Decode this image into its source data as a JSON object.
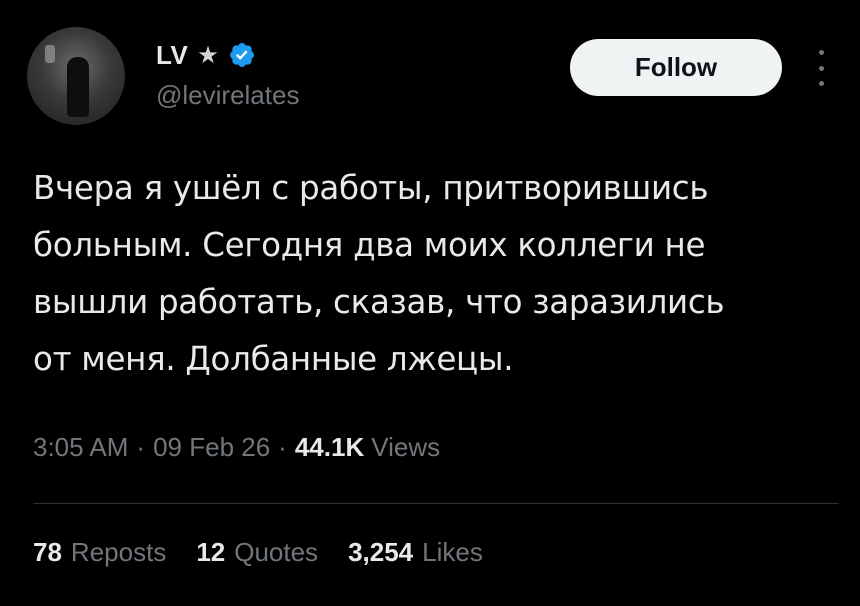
{
  "author": {
    "display_name": "LV",
    "star": "★",
    "handle": "@levirelates",
    "icons": {
      "avatar": "avatar",
      "star": "star-icon",
      "verified": "verified-badge-icon",
      "more": "more-options-icon"
    },
    "verified_color": "#1d9bf0"
  },
  "follow_label": "Follow",
  "tweet": {
    "text": "Вчера я ушёл с работы, притворившись\nбольным. Сегодня два моих коллеги не\nвышли работать, сказав, что заразились\nот меня. Долбанные лжецы."
  },
  "meta": {
    "time": "3:05 AM",
    "date": "09 Feb 26",
    "separator": "·",
    "views_count": "44.1K",
    "views_label": "Views"
  },
  "stats": {
    "reposts_count": "78",
    "reposts_label": "Reposts",
    "quotes_count": "12",
    "quotes_label": "Quotes",
    "likes_count": "3,254",
    "likes_label": "Likes"
  }
}
